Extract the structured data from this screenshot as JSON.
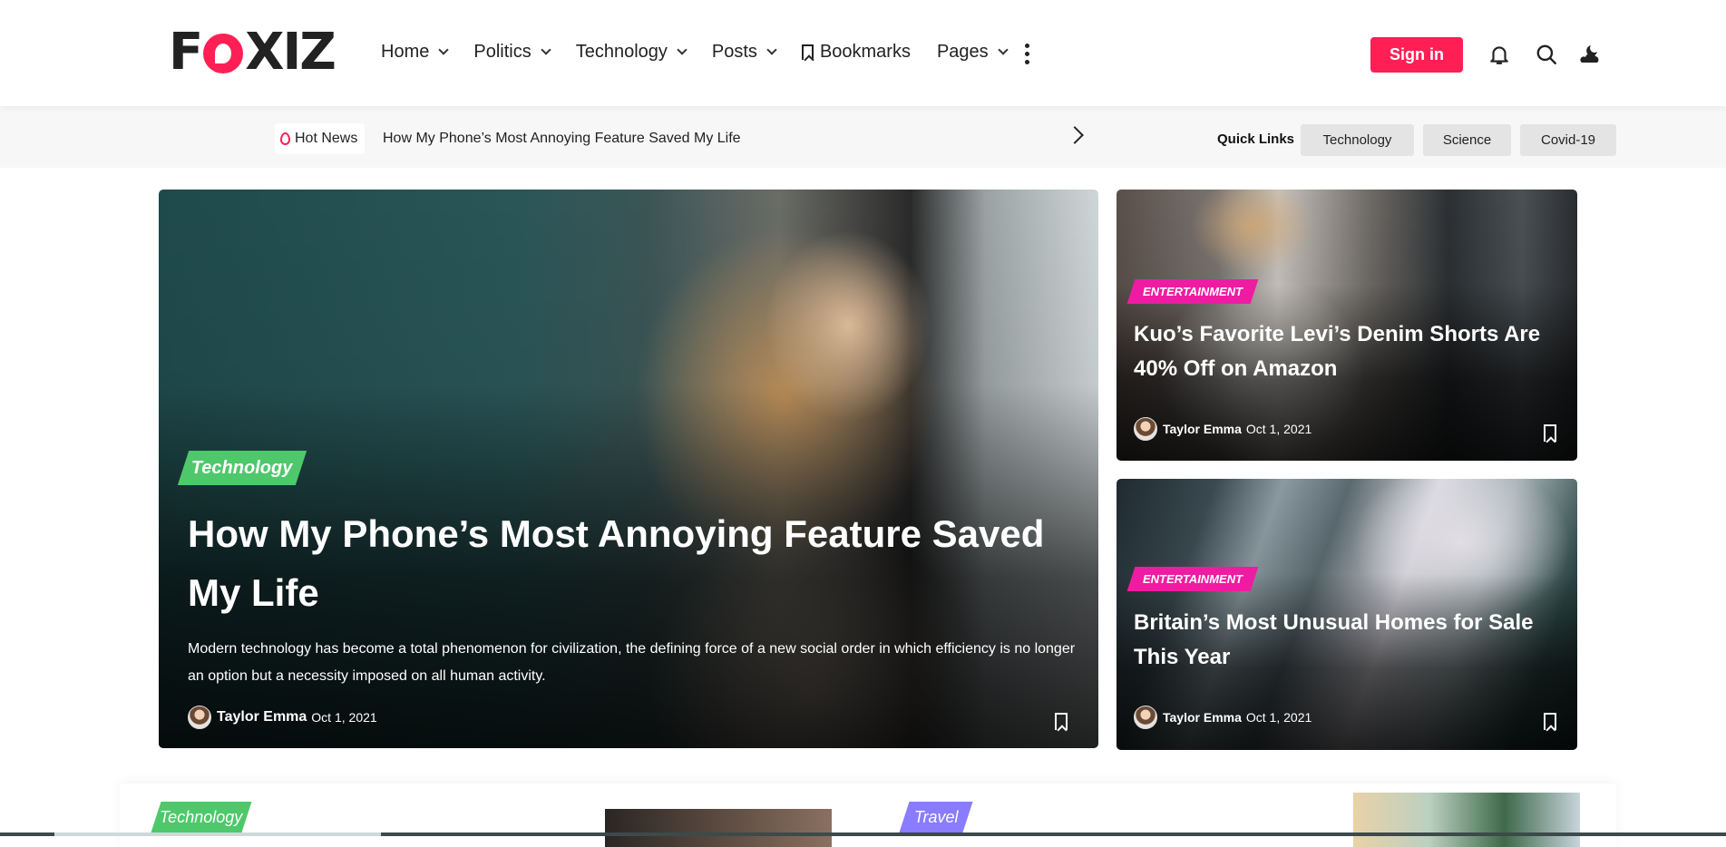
{
  "header": {
    "logo_text": "FOXIZ",
    "nav": [
      {
        "label": "Home",
        "dropdown": true
      },
      {
        "label": "Politics",
        "dropdown": true
      },
      {
        "label": "Technology",
        "dropdown": true
      },
      {
        "label": "Posts",
        "dropdown": true
      },
      {
        "label": "Bookmarks",
        "dropdown": false,
        "icon": "bookmark-icon"
      },
      {
        "label": "Pages",
        "dropdown": true
      }
    ],
    "signin_label": "Sign in",
    "icons": [
      "more-vertical-icon",
      "bell-icon",
      "search-icon",
      "dark-mode-icon"
    ],
    "accent_color": "#ff1f55"
  },
  "hot_news": {
    "label": "Hot News",
    "headline": "How My Phone’s Most Annoying Feature Saved My Life"
  },
  "quick_links": {
    "title": "Quick Links",
    "items": [
      "Technology",
      "Science",
      "Covid-19"
    ]
  },
  "featured": {
    "tag": "Technology",
    "tag_color": "#4ec86b",
    "title": "How My Phone’s Most Annoying Feature Saved My Life",
    "excerpt": "Modern technology has become a total phenomenon for civilization, the defining force of a new social order in which efficiency is no longer an option but a necessity imposed on all human activity.",
    "author": "Taylor Emma",
    "date": "Oct 1, 2021"
  },
  "side_posts": [
    {
      "tag": "ENTERTAINMENT",
      "tag_color": "#ee1ca2",
      "title": "Kuo’s Favorite Levi’s Denim Shorts Are 40% Off on Amazon",
      "author": "Taylor Emma",
      "date": "Oct 1, 2021"
    },
    {
      "tag": "ENTERTAINMENT",
      "tag_color": "#ee1ca2",
      "title": "Britain’s Most Unusual Homes for Sale This Year",
      "author": "Taylor Emma",
      "date": "Oct 1, 2021"
    }
  ],
  "bottom_tags": [
    {
      "label": "Technology",
      "color": "#4ec86b"
    },
    {
      "label": "Travel",
      "color": "#8a7cff"
    }
  ]
}
